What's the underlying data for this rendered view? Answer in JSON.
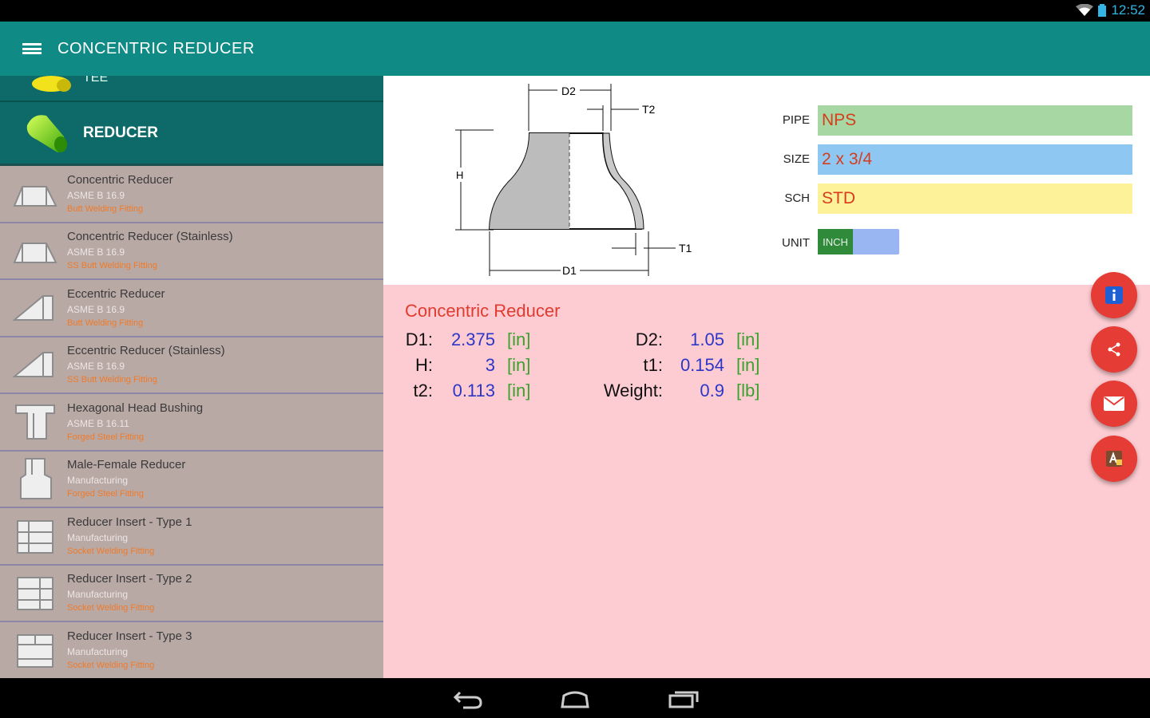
{
  "status_bar": {
    "time": "12:52"
  },
  "app_bar": {
    "title": "CONCENTRIC REDUCER",
    "menu_icon": "hamburger-menu-icon"
  },
  "sidebar": {
    "partial_item_label": "TEE",
    "category": {
      "label": "REDUCER"
    },
    "items": [
      {
        "title": "Concentric Reducer",
        "standard": "ASME B 16.9",
        "type": "Butt Welding Fitting"
      },
      {
        "title": "Concentric Reducer (Stainless)",
        "standard": "ASME B 16.9",
        "type": "SS Butt Welding Fitting"
      },
      {
        "title": "Eccentric Reducer",
        "standard": "ASME B 16.9",
        "type": "Butt Welding Fitting"
      },
      {
        "title": "Eccentric Reducer (Stainless)",
        "standard": "ASME B 16.9",
        "type": "SS Butt Welding Fitting"
      },
      {
        "title": "Hexagonal Head Bushing",
        "standard": "ASME B 16.11",
        "type": "Forged Steel Fitting"
      },
      {
        "title": "Male-Female Reducer",
        "standard": "Manufacturing",
        "type": "Forged Steel Fitting"
      },
      {
        "title": "Reducer Insert - Type 1",
        "standard": "Manufacturing",
        "type": "Socket Welding Fitting"
      },
      {
        "title": "Reducer Insert - Type 2",
        "standard": "Manufacturing",
        "type": "Socket Welding Fitting"
      },
      {
        "title": "Reducer Insert - Type 3",
        "standard": "Manufacturing",
        "type": "Socket Welding Fitting"
      }
    ]
  },
  "diagram": {
    "labels": {
      "d2": "D2",
      "t2": "T2",
      "h": "H",
      "t1": "T1",
      "d1": "D1"
    }
  },
  "inputs": {
    "pipe": {
      "label": "PIPE",
      "value": "NPS",
      "color": "#a7d7a3"
    },
    "size": {
      "label": "SIZE",
      "value": "2 x 3/4",
      "color": "#8fc7f3"
    },
    "sch": {
      "label": "SCH",
      "value": "STD",
      "color": "#fdf19a"
    },
    "unit": {
      "label": "UNIT",
      "value": "INCH"
    }
  },
  "results": {
    "title": "Concentric Reducer",
    "rows": [
      {
        "label": "D1:",
        "value": "2.375",
        "unit": "[in]"
      },
      {
        "label": "H:",
        "value": "3",
        "unit": "[in]"
      },
      {
        "label": "t2:",
        "value": "0.113",
        "unit": "[in]"
      },
      {
        "label": "D2:",
        "value": "1.05",
        "unit": "[in]"
      },
      {
        "label": "t1:",
        "value": "0.154",
        "unit": "[in]"
      },
      {
        "label": "Weight:",
        "value": "0.9",
        "unit": "[lb]"
      }
    ]
  },
  "fabs": [
    "info-icon",
    "share-icon",
    "email-icon",
    "translate-icon"
  ],
  "colors": {
    "app_bar": "#0f8a85",
    "fab": "#e53c35",
    "result_bg": "#fdccd2",
    "value": "#2c36c7",
    "unit": "#3aa12d"
  }
}
